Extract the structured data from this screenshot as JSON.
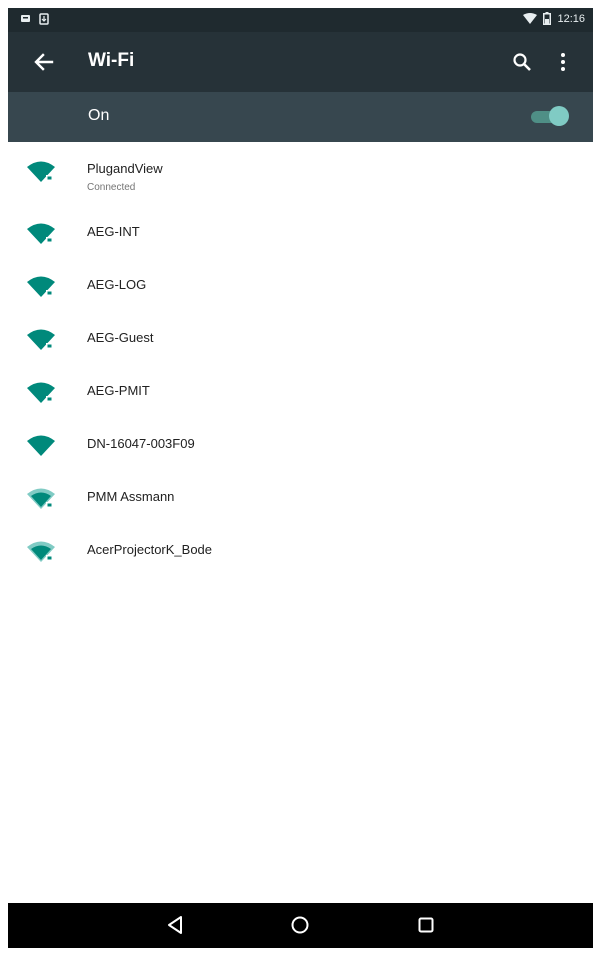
{
  "status_bar": {
    "time": "12:16",
    "icons": [
      "notification-icon",
      "download-icon",
      "wifi-signal-icon",
      "battery-icon"
    ]
  },
  "app_bar": {
    "title": "Wi-Fi",
    "icons": [
      "back-arrow-icon",
      "search-icon",
      "more-vert-icon"
    ]
  },
  "toggle": {
    "label": "On",
    "state": "on",
    "accent_color": "#80cbc4"
  },
  "networks": [
    {
      "ssid": "PlugandView",
      "status": "Connected",
      "secured": true
    },
    {
      "ssid": "AEG-INT",
      "status": "",
      "secured": true
    },
    {
      "ssid": "AEG-LOG",
      "status": "",
      "secured": true
    },
    {
      "ssid": "AEG-Guest",
      "status": "",
      "secured": true
    },
    {
      "ssid": "AEG-PMIT",
      "status": "",
      "secured": true
    },
    {
      "ssid": "DN-16047-003F09",
      "status": "",
      "secured": false
    },
    {
      "ssid": "PMM Assmann",
      "status": "",
      "secured": true
    },
    {
      "ssid": "AcerProjectorK_Bode",
      "status": "",
      "secured": true
    }
  ],
  "nav_bar": {
    "buttons": [
      "nav-back-icon",
      "nav-home-icon",
      "nav-recents-icon"
    ]
  },
  "colors": {
    "status_bar": "#1f2a2f",
    "app_bar": "#263238",
    "toggle_row": "#37474f",
    "wifi_icon": "#00897b"
  }
}
